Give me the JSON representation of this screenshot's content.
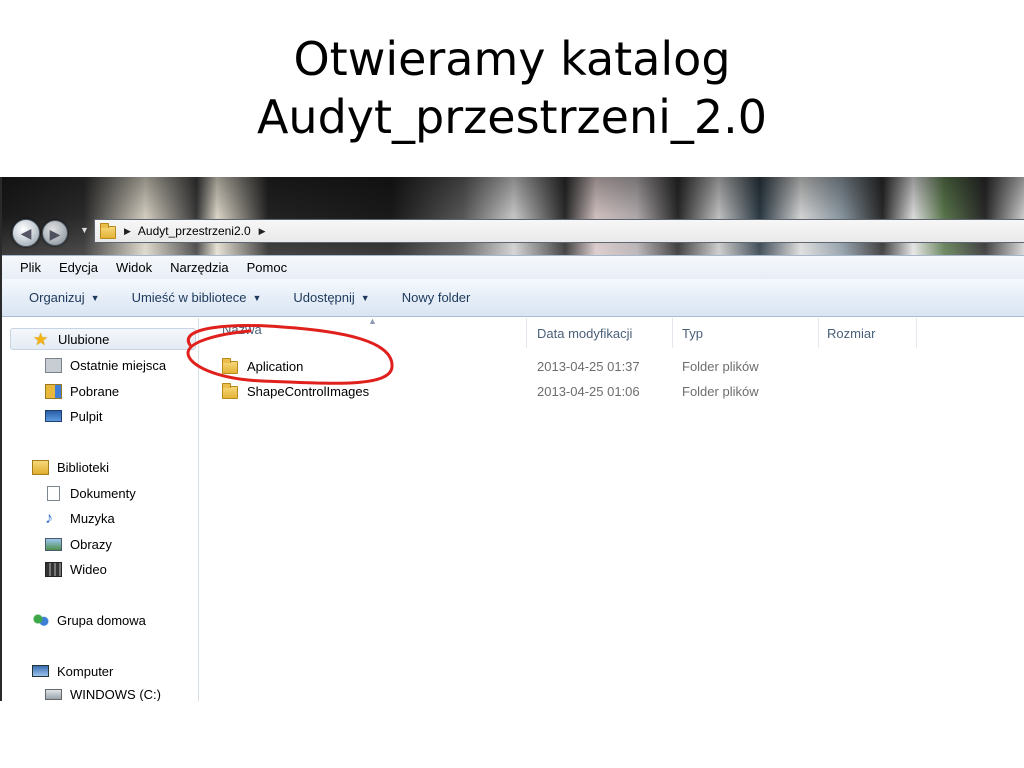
{
  "slide": {
    "title_line1": "Otwieramy katalog",
    "title_line2": "Audyt_przestrzeni_2.0"
  },
  "window": {
    "address": {
      "path": "Audyt_przestrzeni2.0"
    },
    "menu": [
      "Plik",
      "Edycja",
      "Widok",
      "Narzędzia",
      "Pomoc"
    ],
    "commands": {
      "organize": "Organizuj",
      "include_in_library": "Umieść w bibliotece",
      "share": "Udostępnij",
      "new_folder": "Nowy folder"
    },
    "nav_pane": {
      "favorites": "Ulubione",
      "favorites_items": [
        "Ostatnie miejsca",
        "Pobrane",
        "Pulpit"
      ],
      "libraries": "Biblioteki",
      "libraries_items": [
        "Dokumenty",
        "Muzyka",
        "Obrazy",
        "Wideo"
      ],
      "homegroup": "Grupa domowa",
      "computer": "Komputer",
      "computer_items": [
        "WINDOWS (C:)"
      ]
    },
    "columns": {
      "name": "Nazwa",
      "date_modified": "Data modyfikacji",
      "type": "Typ",
      "size": "Rozmiar"
    },
    "files": [
      {
        "name": "Aplication",
        "date": "2013-04-25 01:37",
        "type": "Folder plików"
      },
      {
        "name": "ShapeControlImages",
        "date": "2013-04-25 01:06",
        "type": "Folder plików"
      }
    ],
    "icons": {
      "folder": "folder-icon",
      "star": "star-icon",
      "back": "back-arrow-icon",
      "forward": "forward-arrow-icon"
    },
    "colors": {
      "annotation": "#e0201c",
      "command_text": "#1e395b",
      "column_header_text": "#4c607a"
    }
  }
}
